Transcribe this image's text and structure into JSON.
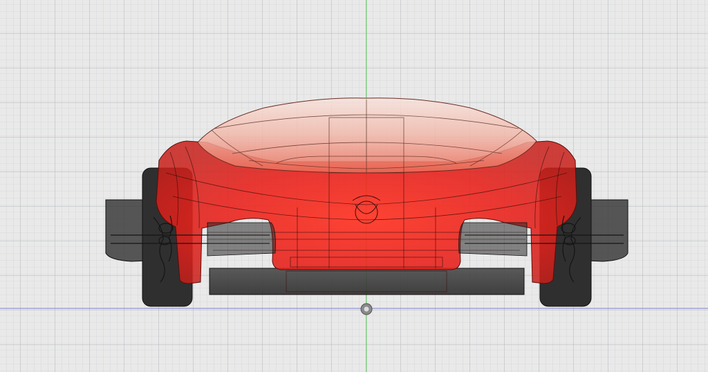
{
  "viewport": {
    "view": "front",
    "background_color": "#e9e9e9",
    "minor_grid_color": "#c9cbd0",
    "major_grid_color": "#b2b5bc",
    "vertical_axis_color": "#6ad46a",
    "horizontal_axis_color": "#7b7fd0"
  },
  "model": {
    "body_color": "#e8231d",
    "body_highlight_color": "#ff4b3a",
    "canopy_color": "#f3c7bc",
    "wheel_color": "#2e2e2e",
    "undertray_color": "#3a3a3a",
    "rendering": "wireframe-translucent"
  },
  "origin_marker": {
    "icon": "origin-point-icon"
  }
}
